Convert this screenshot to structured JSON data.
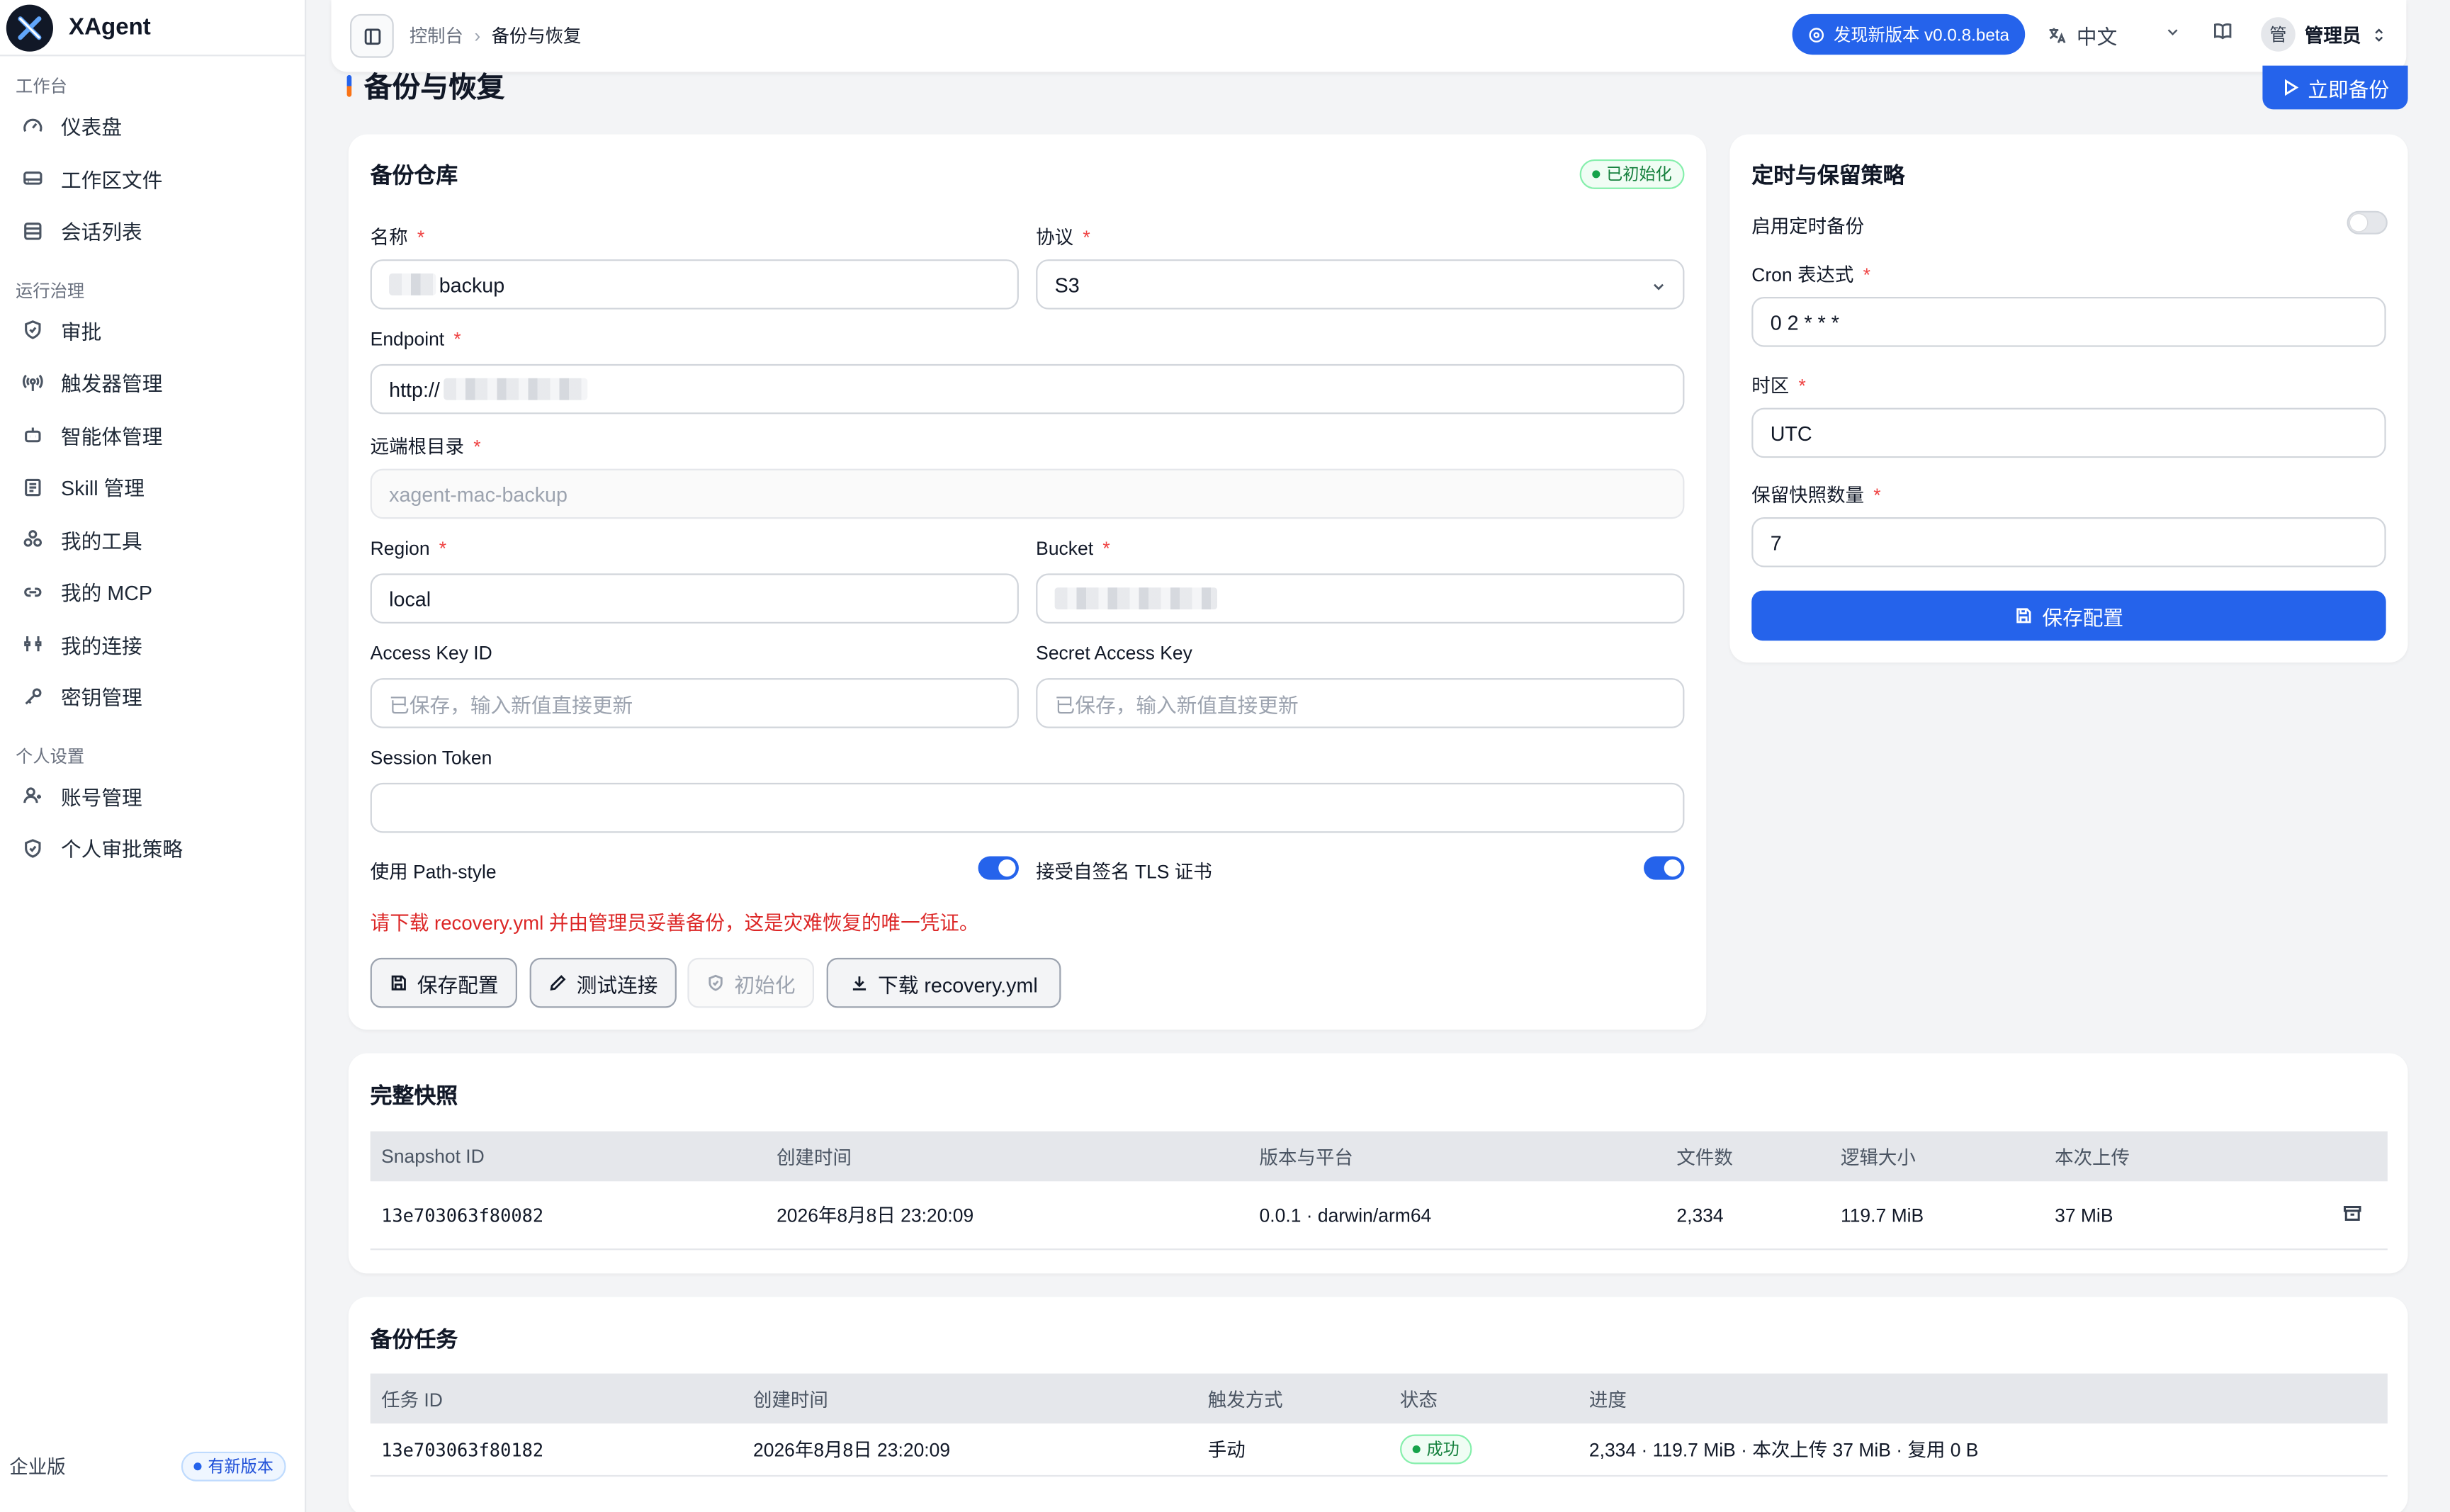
{
  "app": {
    "name": "XAgent"
  },
  "sidebar": {
    "groups": [
      {
        "label": "工作台",
        "items": [
          {
            "label": "仪表盘",
            "icon": "gauge-icon"
          },
          {
            "label": "工作区文件",
            "icon": "drive-icon"
          },
          {
            "label": "会话列表",
            "icon": "list-icon"
          }
        ]
      },
      {
        "label": "运行治理",
        "items": [
          {
            "label": "审批",
            "icon": "shield-icon"
          },
          {
            "label": "触发器管理",
            "icon": "radio-icon"
          },
          {
            "label": "智能体管理",
            "icon": "bot-icon"
          },
          {
            "label": "Skill 管理",
            "icon": "book-icon"
          },
          {
            "label": "我的工具",
            "icon": "blocks-icon"
          },
          {
            "label": "我的 MCP",
            "icon": "link-icon"
          },
          {
            "label": "我的连接",
            "icon": "connection-icon"
          },
          {
            "label": "密钥管理",
            "icon": "key-icon"
          }
        ]
      },
      {
        "label": "个人设置",
        "items": [
          {
            "label": "账号管理",
            "icon": "user-icon"
          },
          {
            "label": "个人审批策略",
            "icon": "shield-check-icon"
          }
        ]
      }
    ],
    "footer": {
      "edition": "企业版",
      "badge": "有新版本"
    }
  },
  "topbar": {
    "breadcrumb": [
      "控制台",
      "备份与恢复"
    ],
    "update": "发现新版本 v0.0.8.beta",
    "language": "中文",
    "avatar": "管",
    "user": "管理员"
  },
  "page": {
    "title": "备份与恢复",
    "backup_now": "立即备份"
  },
  "repo": {
    "title": "备份仓库",
    "status": "已初始化",
    "fields": {
      "name": {
        "label": "名称",
        "value": "backup"
      },
      "protocol": {
        "label": "协议",
        "value": "S3"
      },
      "endpoint": {
        "label": "Endpoint",
        "value": "http://"
      },
      "root": {
        "label": "远端根目录",
        "placeholder": "xagent-mac-backup"
      },
      "region": {
        "label": "Region",
        "value": "local"
      },
      "bucket": {
        "label": "Bucket",
        "value": ""
      },
      "access_key": {
        "label": "Access Key ID",
        "placeholder": "已保存，输入新值直接更新"
      },
      "secret_key": {
        "label": "Secret Access Key",
        "placeholder": "已保存，输入新值直接更新"
      },
      "session_token": {
        "label": "Session Token",
        "value": ""
      }
    },
    "path_style": {
      "label": "使用 Path-style",
      "enabled": true
    },
    "tls": {
      "label": "接受自签名 TLS 证书",
      "enabled": true
    },
    "warning": "请下载 recovery.yml 并由管理员妥善备份，这是灾难恢复的唯一凭证。",
    "buttons": {
      "save": "保存配置",
      "test": "测试连接",
      "init": "初始化",
      "download": "下载 recovery.yml"
    }
  },
  "schedule": {
    "title": "定时与保留策略",
    "enable": {
      "label": "启用定时备份",
      "enabled": false
    },
    "cron": {
      "label": "Cron 表达式",
      "value": "0 2 * * *"
    },
    "timezone": {
      "label": "时区",
      "value": "UTC"
    },
    "retention": {
      "label": "保留快照数量",
      "value": "7"
    },
    "save": "保存配置"
  },
  "snapshots": {
    "title": "完整快照",
    "columns": [
      "Snapshot ID",
      "创建时间",
      "版本与平台",
      "文件数",
      "逻辑大小",
      "本次上传"
    ],
    "rows": [
      {
        "id": "13e703063f80082",
        "created": "2026年8月8日 23:20:09",
        "version": "0.0.1 · darwin/arm64",
        "files": "2,334",
        "size": "119.7 MiB",
        "upload": "37 MiB"
      }
    ]
  },
  "jobs": {
    "title": "备份任务",
    "columns": [
      "任务 ID",
      "创建时间",
      "触发方式",
      "状态",
      "进度"
    ],
    "rows": [
      {
        "id": "13e703063f80182",
        "created": "2026年8月8日 23:20:09",
        "trigger": "手动",
        "status": "成功",
        "progress": "2,334 · 119.7 MiB · 本次上传 37 MiB · 复用 0 B"
      }
    ]
  },
  "colors": {
    "accent": "#2563eb",
    "danger": "#dc2626",
    "success": "#16a34a"
  }
}
